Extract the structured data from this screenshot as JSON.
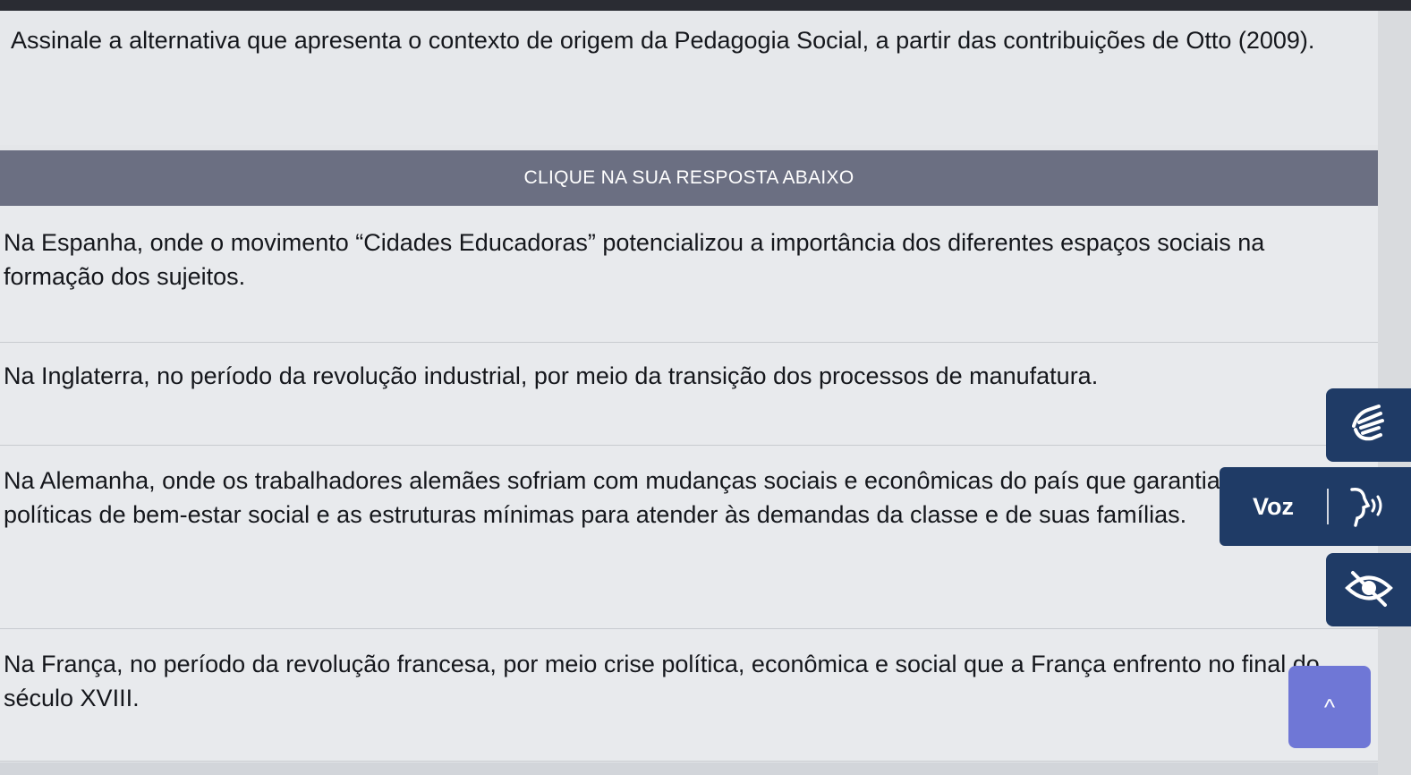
{
  "question": {
    "text": "Assinale a alternativa que apresenta o contexto de origem da Pedagogia Social, a partir das contribuições de Otto (2009)."
  },
  "instruction": "CLIQUE NA SUA RESPOSTA ABAIXO",
  "options": [
    "Na Espanha, onde o movimento “Cidades Educadoras” potencializou a importância dos diferentes espaços sociais na formação dos sujeitos.",
    "Na Inglaterra, no período da revolução industrial, por meio da transição dos processos de manufatura.",
    "Na Alemanha, onde os trabalhadores alemães sofriam com mudanças sociais e econômicas do país que garantiam as políticas de bem-estar social e as estruturas mínimas para atender às demandas da classe e de suas famílias.",
    "Na França, no período da revolução francesa, por meio crise política, econômica e social que a França enfrento no final do século XVIII."
  ],
  "accessibility": {
    "voz_label": "Voz",
    "icons": [
      "sign-language-hand-icon",
      "speaking-head-icon",
      "eye-hidden-icon"
    ]
  },
  "scroll_top_icon": "^",
  "colors": {
    "instruction_bar": "#6b6f82",
    "accessibility_panel": "#1f3b66",
    "scroll_top_button": "#6f77d6"
  }
}
